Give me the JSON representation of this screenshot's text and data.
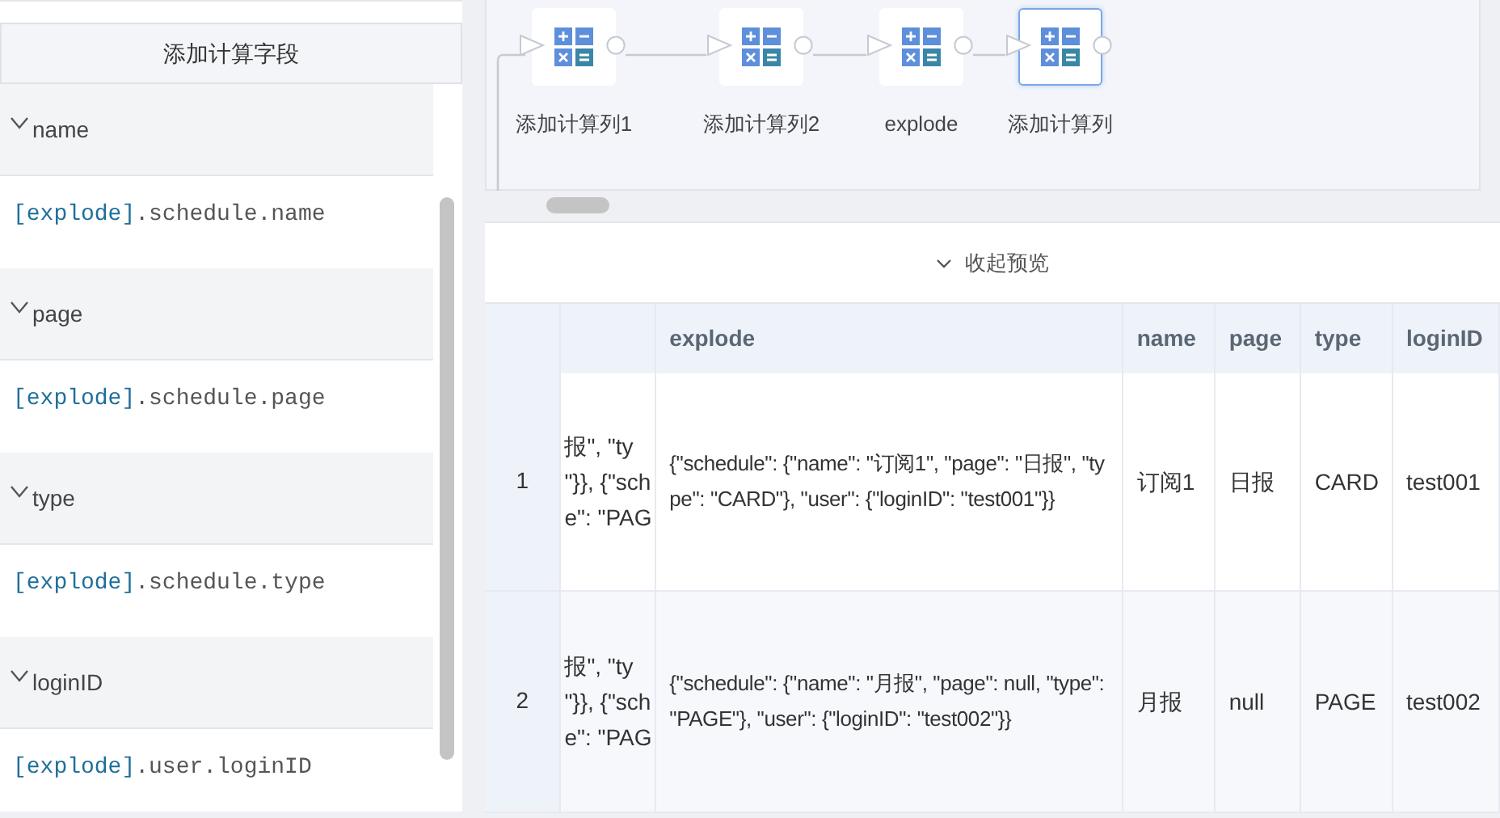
{
  "left_panel": {
    "add_button": "添加计算字段",
    "fields": [
      {
        "name": "name",
        "expanded": true,
        "formula": {
          "source": "[explode]",
          "path": ".schedule.name"
        }
      },
      {
        "name": "page",
        "expanded": true,
        "formula": {
          "source": "[explode]",
          "path": ".schedule.page"
        }
      },
      {
        "name": "type",
        "expanded": true,
        "formula": {
          "source": "[explode]",
          "path": ".schedule.type"
        }
      },
      {
        "name": "loginID",
        "expanded": true,
        "formula": {
          "source": "[explode]",
          "path": ".user.loginID"
        }
      }
    ]
  },
  "flow": {
    "nodes": [
      {
        "label": "添加计算列1",
        "selected": false
      },
      {
        "label": "添加计算列2",
        "selected": false
      },
      {
        "label": "explode",
        "selected": false
      },
      {
        "label": "添加计算列",
        "selected": true
      }
    ]
  },
  "preview_toggle": {
    "label": "收起预览",
    "expanded": true
  },
  "table": {
    "columns": [
      "explode",
      "name",
      "page",
      "type",
      "loginID"
    ],
    "rows": [
      {
        "index": "1",
        "column_2": [
          "报\", \"ty",
          "\"}}, {\"sch",
          "e\": \"PAG"
        ],
        "cells": [
          "{\"schedule\": {\"name\": \"订阅1\", \"page\": \"日报\", \"type\": \"CARD\"}, \"user\": {\"loginID\": \"test001\"}}",
          "订阅1",
          "日报",
          "CARD",
          "test001"
        ]
      },
      {
        "index": "2",
        "column_2": [
          "报\", \"ty",
          "\"}}, {\"sch",
          "e\": \"PAG"
        ],
        "cells": [
          "{\"schedule\": {\"name\": \"月报\", \"page\": null, \"type\": \"PAGE\"}, \"user\": {\"loginID\": \"test002\"}}",
          "月报",
          "null",
          "PAGE",
          "test002"
        ]
      }
    ]
  }
}
